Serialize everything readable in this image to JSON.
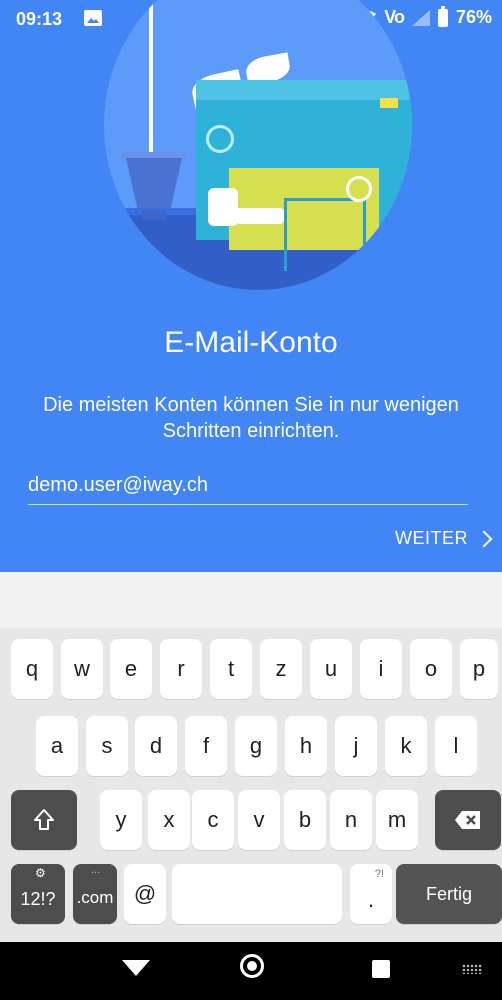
{
  "status_bar": {
    "time": "09:13",
    "volte": "Vo",
    "battery": "76%"
  },
  "title": "E-Mail-Konto",
  "subtitle": "Die meisten Konten können Sie in nur wenigen Schritten einrichten.",
  "email_field": {
    "value": "demo.user@iway.ch",
    "placeholder": ""
  },
  "next_label": "WEITER",
  "keyboard": {
    "row1": [
      "q",
      "w",
      "e",
      "r",
      "t",
      "z",
      "u",
      "i",
      "o",
      "p"
    ],
    "row2": [
      "a",
      "s",
      "d",
      "f",
      "g",
      "h",
      "j",
      "k",
      "l"
    ],
    "row3": [
      "y",
      "x",
      "c",
      "v",
      "b",
      "n",
      "m"
    ],
    "symbols_label": "12!?",
    "com_label": ".com",
    "at_label": "@",
    "period_label": ".",
    "period_hint": "?!",
    "com_hint": "...",
    "done_label": "Fertig"
  },
  "colors": {
    "primary": "#4285f4",
    "keyboard_bg": "#e7e7e7"
  },
  "icons": [
    "image-icon",
    "wifi-icon",
    "signal-icon",
    "battery-icon",
    "shift-icon",
    "backspace-icon",
    "back-icon",
    "home-icon",
    "recents-icon",
    "keyboard-icon",
    "settings-icon"
  ]
}
